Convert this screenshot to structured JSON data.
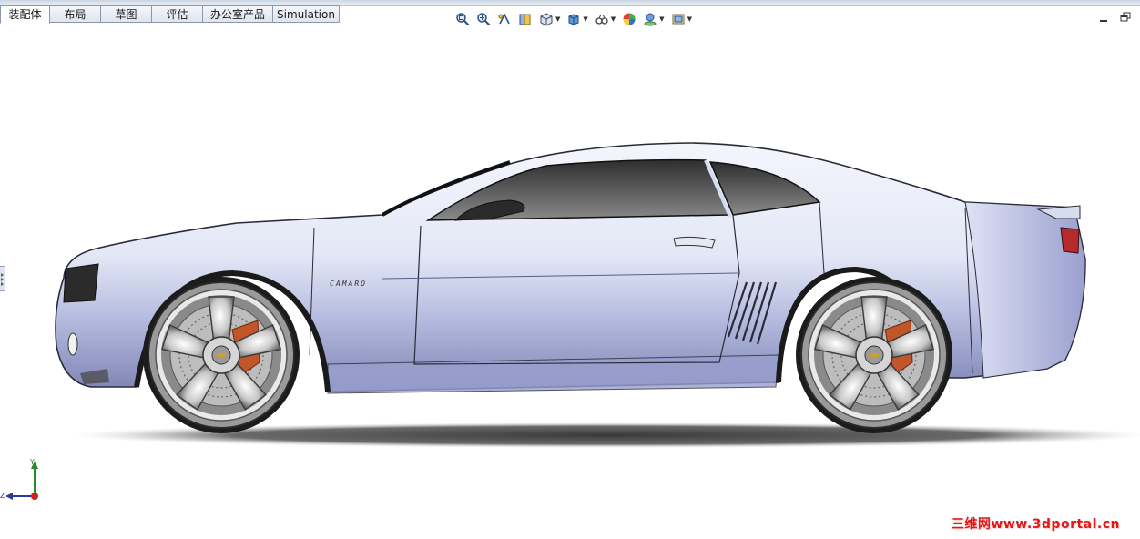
{
  "tabs": [
    {
      "label": "装配体",
      "active": true
    },
    {
      "label": "布局",
      "active": false
    },
    {
      "label": "草图",
      "active": false
    },
    {
      "label": "评估",
      "active": false
    },
    {
      "label": "办公室产品",
      "active": false
    },
    {
      "label": "Simulation",
      "active": false
    }
  ],
  "toolbar": {
    "icons": [
      "zoom-to-fit-icon",
      "zoom-area-icon",
      "previous-view-icon",
      "section-view-icon",
      "view-orientation-icon",
      "display-style-icon",
      "hide-show-items-icon",
      "edit-appearance-icon",
      "apply-scene-icon",
      "view-settings-icon"
    ]
  },
  "car": {
    "badge_text": "CAMARO"
  },
  "triad": {
    "x_label": "Y",
    "z_label": "Z"
  },
  "watermark": "三维网www.3dportal.cn",
  "colors": {
    "body_light": "#eef0fa",
    "body_mid": "#b7bde0",
    "body_dark": "#7d84b3",
    "glass": "#4a4a4a",
    "caliper": "#c0562a",
    "watermark": "#e01818"
  }
}
